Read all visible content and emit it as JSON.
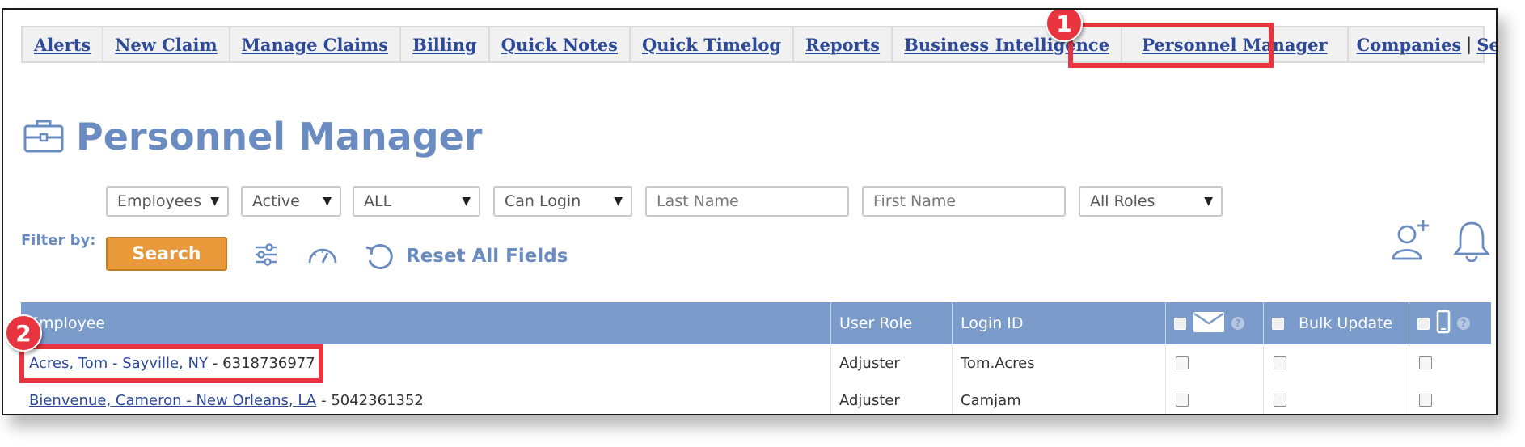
{
  "nav": {
    "items": [
      "Alerts",
      "New Claim",
      "Manage Claims",
      "Billing",
      "Quick Notes",
      "Quick Timelog",
      "Reports",
      "Business Intelligence",
      "Personnel Manager"
    ],
    "companies": "Companies",
    "separator": "|",
    "settings": "Settings"
  },
  "callouts": {
    "one": "1",
    "two": "2"
  },
  "page": {
    "title": "Personnel Manager"
  },
  "filters": {
    "type_select": "Employees",
    "status_select": "Active",
    "scope_select": "ALL",
    "login_select": "Can Login",
    "last_name_placeholder": "Last Name",
    "first_name_placeholder": "First Name",
    "roles_select": "All Roles",
    "filter_by_label": "Filter by:",
    "search_label": "Search",
    "reset_label": "Reset All Fields"
  },
  "table": {
    "headers": {
      "employee": "Employee",
      "user_role": "User Role",
      "login_id": "Login ID",
      "bulk_update": "Bulk Update",
      "help": "?"
    },
    "rows": [
      {
        "employee": "Acres, Tom - Sayville, NY",
        "phone": "- 6318736977",
        "role": "Adjuster",
        "login": "Tom.Acres"
      },
      {
        "employee": "Bienvenue, Cameron - New Orleans, LA",
        "phone": "- 5042361352",
        "role": "Adjuster",
        "login": "Camjam"
      }
    ]
  },
  "colors": {
    "accent_blue": "#6b8cc1",
    "header_blue": "#7b9bcb",
    "link_blue": "#2c4a9a",
    "search_orange": "#e89a3a",
    "callout_red": "#e8343e"
  }
}
